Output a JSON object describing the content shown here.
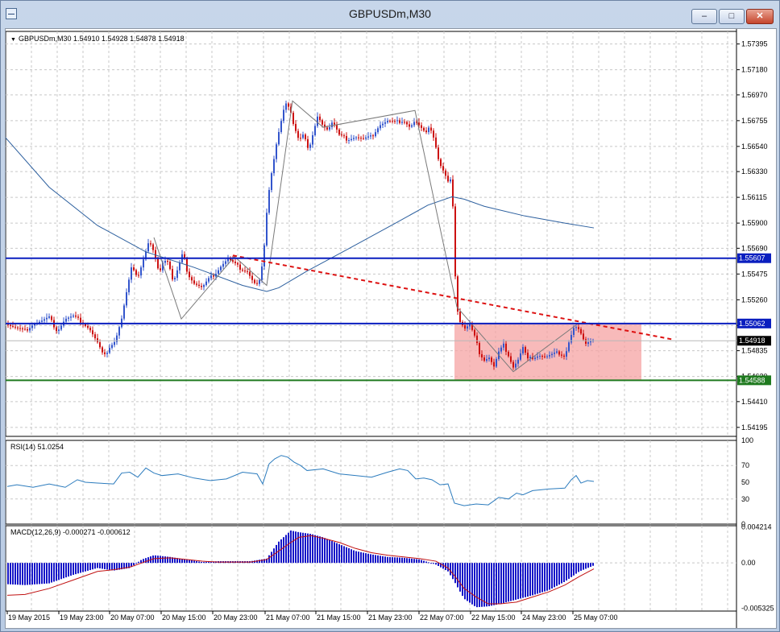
{
  "window": {
    "title": "GBPUSDm,M30",
    "minimize_label": "–",
    "maximize_label": "□",
    "close_label": "✕"
  },
  "colors": {
    "bull": "#3355cc",
    "bear": "#cc1111",
    "blue_line": "#0a1ebf",
    "green_line": "#1f7a1f",
    "trend": "#dd1111",
    "zone": "#f5a3a3",
    "ma": "#2c5f9e",
    "macd_hist": "#1515c8",
    "macd_signal": "#c01010",
    "rsi": "#2b7bbd"
  },
  "chart_data": [
    {
      "type": "candlestick",
      "title": "GBPUSDm,M30",
      "header": "GBPUSDm,M30  1.54910 1.54928 1.54878 1.54918",
      "ylim": [
        1.5412,
        1.575
      ],
      "y_ticks": [
        "1.57395",
        "1.57180",
        "1.56970",
        "1.56755",
        "1.56540",
        "1.56330",
        "1.56115",
        "1.55900",
        "1.55690",
        "1.55475",
        "1.55260",
        "1.55045",
        "1.54835",
        "1.54620",
        "1.54410",
        "1.54195"
      ],
      "x_ticks": [
        "19 May 2015",
        "19 May 23:00",
        "20 May 07:00",
        "20 May 15:00",
        "20 May 23:00",
        "21 May 07:00",
        "21 May 15:00",
        "21 May 23:00",
        "22 May 07:00",
        "22 May 15:00",
        "24 May 23:00",
        "25 May 07:00"
      ],
      "price_path": [
        [
          0,
          1.551
        ],
        [
          10,
          1.5505
        ],
        [
          20,
          1.5502
        ],
        [
          30,
          1.55
        ],
        [
          40,
          1.5506
        ],
        [
          50,
          1.5508
        ],
        [
          60,
          1.5511
        ],
        [
          70,
          1.55
        ],
        [
          80,
          1.551
        ],
        [
          90,
          1.5512
        ],
        [
          100,
          1.5508
        ],
        [
          110,
          1.5502
        ],
        [
          120,
          1.549
        ],
        [
          128,
          1.5478
        ],
        [
          135,
          1.5487
        ],
        [
          142,
          1.5492
        ],
        [
          150,
          1.551
        ],
        [
          157,
          1.5535
        ],
        [
          163,
          1.5555
        ],
        [
          170,
          1.5545
        ],
        [
          177,
          1.556
        ],
        [
          184,
          1.5575
        ],
        [
          190,
          1.5565
        ],
        [
          196,
          1.5548
        ],
        [
          202,
          1.556
        ],
        [
          208,
          1.5558
        ],
        [
          214,
          1.554
        ],
        [
          220,
          1.5552
        ],
        [
          226,
          1.5565
        ],
        [
          232,
          1.5548
        ],
        [
          240,
          1.554
        ],
        [
          250,
          1.5536
        ],
        [
          258,
          1.5543
        ],
        [
          266,
          1.5548
        ],
        [
          274,
          1.5555
        ],
        [
          282,
          1.556
        ],
        [
          290,
          1.5556
        ],
        [
          298,
          1.5552
        ],
        [
          306,
          1.555
        ],
        [
          314,
          1.554
        ],
        [
          320,
          1.5538
        ],
        [
          326,
          1.556
        ],
        [
          330,
          1.56
        ],
        [
          334,
          1.5625
        ],
        [
          338,
          1.564
        ],
        [
          343,
          1.566
        ],
        [
          348,
          1.5675
        ],
        [
          353,
          1.569
        ],
        [
          358,
          1.5685
        ],
        [
          364,
          1.5672
        ],
        [
          370,
          1.566
        ],
        [
          376,
          1.5665
        ],
        [
          382,
          1.565
        ],
        [
          388,
          1.5665
        ],
        [
          394,
          1.568
        ],
        [
          400,
          1.5672
        ],
        [
          406,
          1.5668
        ],
        [
          412,
          1.5675
        ],
        [
          420,
          1.5663
        ],
        [
          430,
          1.566
        ],
        [
          440,
          1.5662
        ],
        [
          450,
          1.566
        ],
        [
          460,
          1.5662
        ],
        [
          470,
          1.5672
        ],
        [
          480,
          1.5675
        ],
        [
          490,
          1.5674
        ],
        [
          500,
          1.5676
        ],
        [
          508,
          1.567
        ],
        [
          514,
          1.5675
        ],
        [
          520,
          1.567
        ],
        [
          526,
          1.5665
        ],
        [
          532,
          1.5672
        ],
        [
          538,
          1.566
        ],
        [
          544,
          1.564
        ],
        [
          550,
          1.5632
        ],
        [
          556,
          1.5622
        ],
        [
          560,
          1.5628
        ],
        [
          563,
          1.556
        ],
        [
          566,
          1.552
        ],
        [
          570,
          1.5508
        ],
        [
          576,
          1.5502
        ],
        [
          582,
          1.5505
        ],
        [
          588,
          1.5495
        ],
        [
          594,
          1.5482
        ],
        [
          600,
          1.5476
        ],
        [
          606,
          1.5478
        ],
        [
          612,
          1.547
        ],
        [
          618,
          1.5482
        ],
        [
          624,
          1.5488
        ],
        [
          630,
          1.548
        ],
        [
          636,
          1.547
        ],
        [
          642,
          1.5476
        ],
        [
          648,
          1.5486
        ],
        [
          654,
          1.5476
        ],
        [
          660,
          1.5478
        ],
        [
          668,
          1.548
        ],
        [
          676,
          1.5478
        ],
        [
          684,
          1.548
        ],
        [
          692,
          1.5482
        ],
        [
          700,
          1.5479
        ],
        [
          706,
          1.5493
        ],
        [
          712,
          1.5504
        ],
        [
          718,
          1.55
        ],
        [
          724,
          1.549
        ],
        [
          730,
          1.5492
        ],
        [
          736,
          1.5493
        ]
      ],
      "moving_average": [
        [
          5,
          1.5662
        ],
        [
          60,
          1.562
        ],
        [
          120,
          1.5588
        ],
        [
          180,
          1.5566
        ],
        [
          240,
          1.5553
        ],
        [
          300,
          1.5538
        ],
        [
          330,
          1.5533
        ],
        [
          345,
          1.5536
        ],
        [
          380,
          1.555
        ],
        [
          430,
          1.5568
        ],
        [
          490,
          1.559
        ],
        [
          530,
          1.5605
        ],
        [
          560,
          1.5612
        ],
        [
          575,
          1.561
        ],
        [
          600,
          1.5604
        ],
        [
          650,
          1.5596
        ],
        [
          700,
          1.559
        ],
        [
          736,
          1.5586
        ]
      ],
      "zigzag": [
        [
          190,
          1.5578
        ],
        [
          224,
          1.551
        ],
        [
          290,
          1.5562
        ],
        [
          330,
          1.5538
        ],
        [
          362,
          1.5692
        ],
        [
          400,
          1.567
        ],
        [
          514,
          1.5684
        ],
        [
          566,
          1.552
        ],
        [
          636,
          1.5466
        ],
        [
          716,
          1.5506
        ]
      ],
      "trend_line": [
        [
          288,
          1.5563
        ],
        [
          833,
          1.5493
        ]
      ],
      "levels": [
        {
          "label": "1.55607",
          "value": 1.55607,
          "style": "blue"
        },
        {
          "label": "1.55062",
          "value": 1.55062,
          "style": "blue"
        },
        {
          "label": "1.54588",
          "value": 1.54588,
          "style": "green"
        }
      ],
      "current_price": {
        "label": "1.54918",
        "value": 1.54918
      },
      "zone": {
        "price_top": 1.55062,
        "price_bottom": 1.54588,
        "x_start": 563,
        "x_end": 795
      }
    },
    {
      "type": "line",
      "title": "RSI(14) 51.0254",
      "ylim": [
        0,
        100
      ],
      "y_ticks": [
        "100",
        "70",
        "50",
        "30",
        "0"
      ],
      "series": [
        {
          "name": "RSI(14)",
          "values": [
            [
              8,
              45
            ],
            [
              20,
              47
            ],
            [
              40,
              44
            ],
            [
              60,
              48
            ],
            [
              80,
              44
            ],
            [
              95,
              53
            ],
            [
              105,
              50
            ],
            [
              120,
              49
            ],
            [
              140,
              48
            ],
            [
              150,
              61
            ],
            [
              160,
              62
            ],
            [
              170,
              56
            ],
            [
              180,
              67
            ],
            [
              190,
              61
            ],
            [
              200,
              58
            ],
            [
              220,
              60
            ],
            [
              240,
              55
            ],
            [
              260,
              52
            ],
            [
              280,
              54
            ],
            [
              300,
              62
            ],
            [
              318,
              60
            ],
            [
              325,
              48
            ],
            [
              333,
              72
            ],
            [
              340,
              78
            ],
            [
              348,
              82
            ],
            [
              356,
              80
            ],
            [
              364,
              74
            ],
            [
              372,
              70
            ],
            [
              380,
              64
            ],
            [
              400,
              66
            ],
            [
              420,
              60
            ],
            [
              440,
              58
            ],
            [
              460,
              56
            ],
            [
              480,
              62
            ],
            [
              495,
              66
            ],
            [
              505,
              64
            ],
            [
              515,
              54
            ],
            [
              525,
              55
            ],
            [
              535,
              53
            ],
            [
              545,
              47
            ],
            [
              555,
              48
            ],
            [
              563,
              25
            ],
            [
              575,
              22
            ],
            [
              590,
              24
            ],
            [
              605,
              23
            ],
            [
              618,
              32
            ],
            [
              630,
              30
            ],
            [
              640,
              37
            ],
            [
              648,
              35
            ],
            [
              660,
              40
            ],
            [
              680,
              42
            ],
            [
              700,
              43
            ],
            [
              708,
              53
            ],
            [
              714,
              58
            ],
            [
              720,
              49
            ],
            [
              728,
              52
            ],
            [
              736,
              51
            ]
          ]
        }
      ]
    },
    {
      "type": "bar",
      "title": "MACD(12,26,9) -0.000271 -0.000612",
      "ylim": [
        -0.00565,
        0.00436
      ],
      "y_ticks": [
        "0.004214",
        "0.00",
        "-0.005325"
      ],
      "series": [
        {
          "name": "MACD",
          "values": [
            [
              8,
              -0.0025
            ],
            [
              30,
              -0.0026
            ],
            [
              60,
              -0.0024
            ],
            [
              90,
              -0.0014
            ],
            [
              120,
              -0.0006
            ],
            [
              140,
              -0.0009
            ],
            [
              160,
              -0.0006
            ],
            [
              175,
              0.0004
            ],
            [
              190,
              0.0009
            ],
            [
              210,
              0.0007
            ],
            [
              230,
              0.0004
            ],
            [
              250,
              0.0001
            ],
            [
              270,
              0.0002
            ],
            [
              290,
              0.0002
            ],
            [
              310,
              0.0002
            ],
            [
              330,
              0.0005
            ],
            [
              345,
              0.0025
            ],
            [
              360,
              0.0038
            ],
            [
              370,
              0.0036
            ],
            [
              385,
              0.0034
            ],
            [
              400,
              0.003
            ],
            [
              420,
              0.0022
            ],
            [
              440,
              0.0014
            ],
            [
              460,
              0.001
            ],
            [
              480,
              0.0007
            ],
            [
              500,
              0.0006
            ],
            [
              520,
              0.0004
            ],
            [
              540,
              -0.0002
            ],
            [
              555,
              -0.001
            ],
            [
              563,
              -0.0022
            ],
            [
              575,
              -0.0042
            ],
            [
              590,
              -0.0052
            ],
            [
              605,
              -0.0051
            ],
            [
              620,
              -0.0048
            ],
            [
              640,
              -0.0043
            ],
            [
              660,
              -0.0038
            ],
            [
              680,
              -0.0032
            ],
            [
              700,
              -0.0022
            ],
            [
              718,
              -0.001
            ],
            [
              736,
              -0.0003
            ]
          ]
        },
        {
          "name": "Signal",
          "values": [
            [
              8,
              -0.0038
            ],
            [
              30,
              -0.0037
            ],
            [
              60,
              -0.003
            ],
            [
              90,
              -0.002
            ],
            [
              120,
              -0.001
            ],
            [
              140,
              -0.0008
            ],
            [
              160,
              -0.0005
            ],
            [
              175,
              0.0
            ],
            [
              190,
              0.0005
            ],
            [
              210,
              0.0006
            ],
            [
              230,
              0.0004
            ],
            [
              250,
              0.0002
            ],
            [
              270,
              0.0001
            ],
            [
              290,
              0.0001
            ],
            [
              310,
              0.0001
            ],
            [
              330,
              0.0004
            ],
            [
              345,
              0.0014
            ],
            [
              360,
              0.0024
            ],
            [
              370,
              0.003
            ],
            [
              385,
              0.0032
            ],
            [
              400,
              0.0029
            ],
            [
              420,
              0.0024
            ],
            [
              440,
              0.0017
            ],
            [
              460,
              0.0012
            ],
            [
              480,
              0.0009
            ],
            [
              500,
              0.0007
            ],
            [
              520,
              0.0005
            ],
            [
              540,
              0.0002
            ],
            [
              555,
              -0.0006
            ],
            [
              563,
              -0.0015
            ],
            [
              575,
              -0.003
            ],
            [
              590,
              -0.004
            ],
            [
              605,
              -0.0048
            ],
            [
              620,
              -0.0048
            ],
            [
              640,
              -0.0046
            ],
            [
              660,
              -0.004
            ],
            [
              680,
              -0.0034
            ],
            [
              700,
              -0.0026
            ],
            [
              718,
              -0.0016
            ],
            [
              736,
              -0.0007
            ]
          ]
        }
      ]
    }
  ]
}
